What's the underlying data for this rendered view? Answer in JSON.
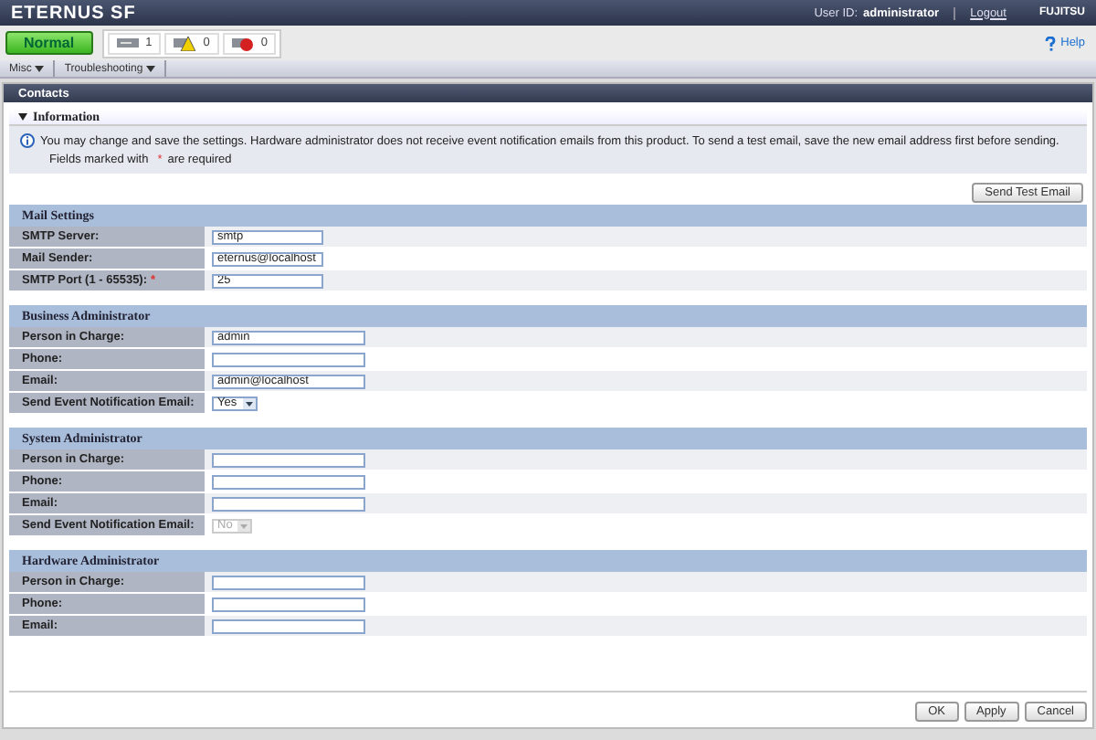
{
  "header": {
    "product": "ETERNUS SF",
    "user_label": "User ID:",
    "user": "administrator",
    "logout": "Logout",
    "brand": "FUJITSU"
  },
  "status": {
    "state": "Normal",
    "counters": [
      {
        "kind": "info",
        "count": "1"
      },
      {
        "kind": "warning",
        "count": "0"
      },
      {
        "kind": "error",
        "count": "0"
      }
    ],
    "help": "Help"
  },
  "menu": [
    {
      "label": "Misc"
    },
    {
      "label": "Troubleshooting"
    }
  ],
  "page_title": "Contacts",
  "information": {
    "title": "Information",
    "expanded": true,
    "message": "You may change and save the settings. Hardware administrator does not receive event notification emails from this product. To send a test email, save the new email address first before sending.",
    "required_note": [
      "Fields marked with",
      "*",
      "are required"
    ]
  },
  "send_test_button": "Send Test Email",
  "sections": [
    {
      "title": "Mail Settings",
      "fields": [
        {
          "label": "SMTP Server:",
          "kind": "text",
          "value": "smtp"
        },
        {
          "label": "Mail Sender:",
          "kind": "text",
          "value": "eternus@localhost"
        },
        {
          "label": "SMTP Port (1 - 65535):",
          "kind": "text",
          "value": "25",
          "required_mark": "*"
        }
      ]
    },
    {
      "title": "Business Administrator",
      "fields": [
        {
          "label": "Person in Charge:",
          "kind": "text",
          "value": "admin"
        },
        {
          "label": "Phone:",
          "kind": "text"
        },
        {
          "label": "Email:",
          "kind": "text",
          "value": "admin@localhost"
        },
        {
          "label": "Send Event Notification Email:",
          "kind": "select",
          "value": "Yes",
          "disabled": false
        }
      ]
    },
    {
      "title": "System Administrator",
      "fields": [
        {
          "label": "Person in Charge:",
          "kind": "text"
        },
        {
          "label": "Phone:",
          "kind": "text"
        },
        {
          "label": "Email:",
          "kind": "text"
        },
        {
          "label": "Send Event Notification Email:",
          "kind": "select",
          "value": "No",
          "disabled": true
        }
      ]
    },
    {
      "title": "Hardware Administrator",
      "fields": [
        {
          "label": "Person in Charge:",
          "kind": "text"
        },
        {
          "label": "Phone:",
          "kind": "text"
        },
        {
          "label": "Email:",
          "kind": "text"
        }
      ]
    }
  ],
  "buttons": [
    "OK",
    "Apply",
    "Cancel"
  ]
}
